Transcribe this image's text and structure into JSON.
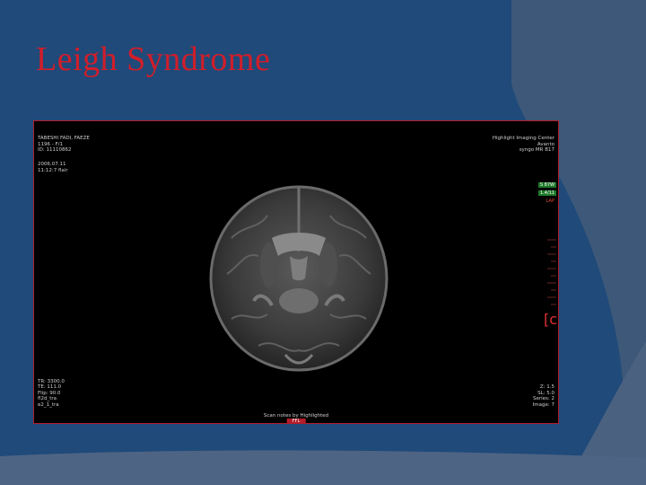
{
  "slide": {
    "title": "Leigh Syndrome"
  },
  "overlay": {
    "top_left": [
      "TABESHI FADI, FAEZE",
      "1196 - F/1",
      "ID: 11110862"
    ],
    "top_left_2": [
      "2006.07.11",
      "11:12:7 flair"
    ],
    "top_right": [
      "Highlight Imaging Center",
      "Avanto",
      "syngo MR B17"
    ],
    "tag1": "S 87W",
    "tag2": "1.4/11",
    "tag3": "LAP",
    "bracket": "[c",
    "bottom_left": [
      "TR: 3300.0",
      "TE: 111.0",
      "Flip: 90.0",
      "fl2d_tra",
      "e2_1_tra"
    ],
    "bottom_right": [
      "Z: 1.5",
      "SL: 5.0",
      "Series: 2",
      "Image: 7"
    ],
    "bottom_center": "Scan notes by Highlighted",
    "orientation_badge": "FFL"
  },
  "colors": {
    "background": "#1f4a7a",
    "title": "#d01e2a",
    "frame_border": "#b31c2a"
  }
}
